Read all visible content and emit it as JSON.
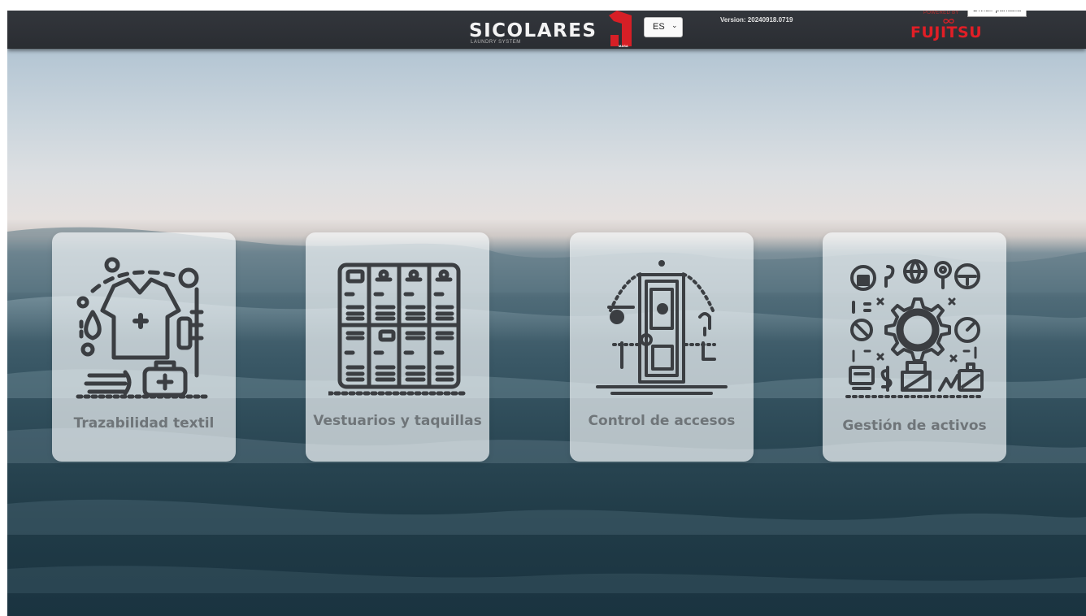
{
  "header": {
    "logo_text": "SICOLARES",
    "logo_subtext": "LAUNDRY SYSTEM",
    "logo_mark_text": "MASA",
    "language": "ES",
    "version": "Version: 20240918.0719",
    "powered_by": "POWERED BY",
    "partner_logo": "FUJITSU",
    "tooltip": "Dividir pantalla"
  },
  "cards": [
    {
      "label": "Trazabilidad textil",
      "icon": "textile-traceability-icon"
    },
    {
      "label": "Vestuarios y taquillas",
      "icon": "lockers-icon"
    },
    {
      "label": "Control de accesos",
      "icon": "access-control-door-icon"
    },
    {
      "label": "Gestión de activos",
      "icon": "asset-management-gear-icon"
    }
  ],
  "colors": {
    "header_bg": "#2f3237",
    "brand_red": "#e11e26",
    "card_text": "#6f7579",
    "icon_stroke": "#3b3e42"
  }
}
